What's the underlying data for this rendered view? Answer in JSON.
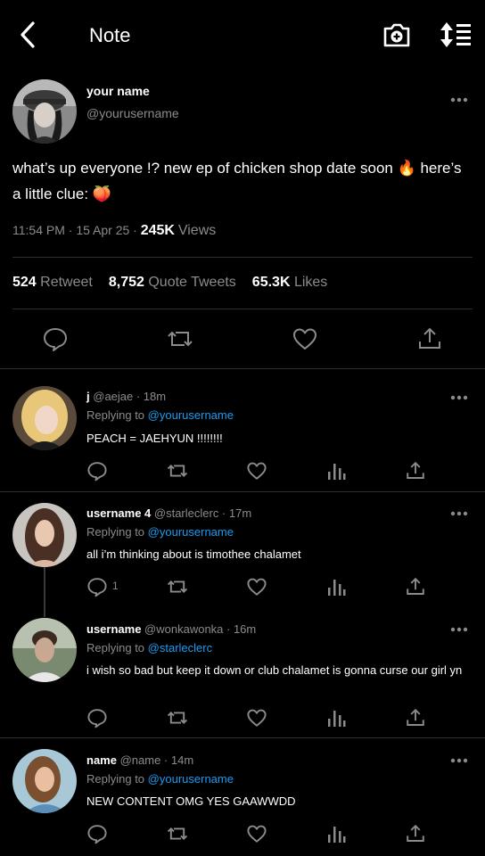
{
  "header": {
    "title": "Note",
    "back_icon": "chevron-left-icon",
    "camera_icon": "camera-plus-icon",
    "sort_icon": "sort-list-icon"
  },
  "tweet": {
    "name": "your name",
    "handle": "@yourusername",
    "text": "what’s up everyone !? new ep of chicken shop date soon 🔥 here’s a little clue: 🍑",
    "time": "11:54 PM · 15 Apr 25 · ",
    "views_count": "245K",
    "views_label": "Views",
    "retweet_count": "524",
    "retweet_label": "Retweet",
    "quote_count": "8,752",
    "quote_label": "Quote Tweets",
    "likes_count": "65.3K",
    "likes_label": "Likes"
  },
  "replies": [
    {
      "name": "j",
      "meta": "@aejae · 18m",
      "replying_label": "Replying to",
      "replying_to": "@yourusername",
      "text": "PEACH = JAEHYUN !!!!!!!!",
      "reply_count": ""
    },
    {
      "name": "username 4",
      "meta": "@starleclerc · 17m",
      "replying_label": "Replying to",
      "replying_to": "@yourusername",
      "text": "all i’m thinking about is timothee chalamet",
      "reply_count": "1"
    },
    {
      "name": "username",
      "meta": "@wonkawonka · 16m",
      "replying_label": "Replying to",
      "replying_to": "@starleclerc",
      "text": "i wish so bad but keep it down or club chalamet is gonna curse our girl yn",
      "reply_count": ""
    },
    {
      "name": "name",
      "meta": "@name · 14m",
      "replying_label": "Replying to",
      "replying_to": "@yourusername",
      "text": "NEW CONTENT OMG YES GAAWWDD",
      "reply_count": ""
    }
  ],
  "colors": {
    "background": "#000000",
    "secondary_text": "#8b8b8b",
    "link": "#1d9bf0",
    "divider": "#2f2f2f"
  }
}
